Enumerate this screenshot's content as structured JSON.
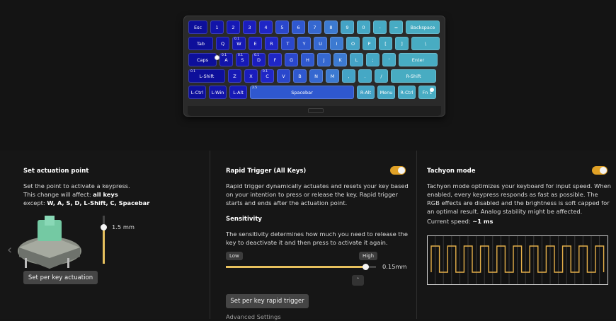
{
  "keyboard": {
    "rows": [
      [
        {
          "label": "Esc",
          "c": "#0d0f9a"
        },
        {
          "label": "1",
          "c": "#1214a8"
        },
        {
          "label": "2",
          "c": "#1619b5"
        },
        {
          "label": "3",
          "c": "#1a1dbd"
        },
        {
          "label": "4",
          "c": "#1f26c6"
        },
        {
          "label": "5",
          "c": "#2a47cc"
        },
        {
          "label": "6",
          "c": "#2f58cf"
        },
        {
          "label": "7",
          "c": "#3568d0"
        },
        {
          "label": "8",
          "c": "#3c7ad1"
        },
        {
          "label": "9",
          "c": "#44a3c6"
        },
        {
          "label": "0",
          "c": "#45a8c5"
        },
        {
          "label": "-",
          "c": "#46aac4"
        },
        {
          "label": "=",
          "c": "#47abc3"
        },
        {
          "label": "Backspace",
          "c": "#48acc2"
        }
      ],
      [
        {
          "label": "Tab",
          "c": "#0d0f9a"
        },
        {
          "label": "Q",
          "c": "#1214a8"
        },
        {
          "label": "W",
          "c": "#1619b5",
          "sup": "0.1"
        },
        {
          "label": "E",
          "c": "#1a1dbd"
        },
        {
          "label": "R",
          "c": "#1f26c6"
        },
        {
          "label": "T",
          "c": "#2a47cc"
        },
        {
          "label": "Y",
          "c": "#2f58cf"
        },
        {
          "label": "U",
          "c": "#3568d0"
        },
        {
          "label": "I",
          "c": "#3c7ad1"
        },
        {
          "label": "O",
          "c": "#44a3c6"
        },
        {
          "label": "P",
          "c": "#45a8c5"
        },
        {
          "label": "[",
          "c": "#46aac4"
        },
        {
          "label": "]",
          "c": "#47abc3"
        },
        {
          "label": "\\",
          "c": "#48acc2"
        }
      ],
      [
        {
          "label": "Caps",
          "c": "#0d0f9a"
        },
        {
          "label": "A",
          "c": "#1214a8",
          "sup": "0.1"
        },
        {
          "label": "S",
          "c": "#1619b5",
          "sup": "0.1"
        },
        {
          "label": "D",
          "c": "#1a1dbd",
          "sup": "0.1"
        },
        {
          "label": "F",
          "c": "#1f26c6"
        },
        {
          "label": "G",
          "c": "#2a47cc"
        },
        {
          "label": "H",
          "c": "#2f58cf"
        },
        {
          "label": "J",
          "c": "#3568d0"
        },
        {
          "label": "K",
          "c": "#3c7ad1"
        },
        {
          "label": "L",
          "c": "#44a3c6"
        },
        {
          "label": ";",
          "c": "#45a8c5"
        },
        {
          "label": "'",
          "c": "#46aac4"
        },
        {
          "label": "Enter",
          "c": "#48acc2"
        }
      ],
      [
        {
          "label": "L-Shift",
          "c": "#0d0f9a",
          "sup": "0.1"
        },
        {
          "label": "Z",
          "c": "#1619b5"
        },
        {
          "label": "X",
          "c": "#1a1dbd"
        },
        {
          "label": "C",
          "c": "#1f26c6",
          "sup": "0.1"
        },
        {
          "label": "V",
          "c": "#2a47cc"
        },
        {
          "label": "B",
          "c": "#2f58cf"
        },
        {
          "label": "N",
          "c": "#3568d0"
        },
        {
          "label": "M",
          "c": "#3c7ad1"
        },
        {
          "label": ",",
          "c": "#44a3c6"
        },
        {
          "label": ".",
          "c": "#45a8c5"
        },
        {
          "label": "/",
          "c": "#46aac4"
        },
        {
          "label": "R-Shift",
          "c": "#48acc2"
        }
      ],
      [
        {
          "label": "L-Ctrl",
          "c": "#0d0f9a"
        },
        {
          "label": "L-Win",
          "c": "#1214a8"
        },
        {
          "label": "L-Alt",
          "c": "#1619b5"
        },
        {
          "label": "Spacebar",
          "c": "#2f58cf",
          "sup": "2.5"
        },
        {
          "label": "R-Alt",
          "c": "#44a3c6"
        },
        {
          "label": "Menu",
          "c": "#45a8c5"
        },
        {
          "label": "R-Ctrl",
          "c": "#46aac4"
        },
        {
          "label": "Fn 1",
          "c": "#48acc2"
        }
      ]
    ]
  },
  "actuation": {
    "title": "Set actuation point",
    "desc1": "Set the point to activate a keypress.",
    "desc2_prefix": "This change will affect: ",
    "desc2_bold": "all keys",
    "desc3_prefix": "except: ",
    "desc3_bold": "W, A, S, D, L-Shift, C, Spacebar",
    "value": "1.5 mm",
    "button": "Set per key actuation",
    "prev_icon": "chevron-left-icon"
  },
  "rapid": {
    "title": "Rapid Trigger (All Keys)",
    "desc": "Rapid trigger dynamically actuates and resets your key based on your intention to press or release the key. Rapid trigger starts and ends after the actuation point.",
    "sens_title": "Sensitivity",
    "sens_desc": "The sensitivity determines how much you need to release the key to deactivate it and then press to activate it again.",
    "low": "Low",
    "high": "High",
    "value": "0.15mm",
    "level": 0.93,
    "button": "Set per key rapid trigger",
    "advanced": "Advanced Settings"
  },
  "tachyon": {
    "title": "Tachyon mode",
    "desc": "Tachyon mode optimizes your keyboard for input speed. When enabled, every keypress responds as fast as possible. The RGB effects are disabled and the brightness is soft capped for an optimal result. Analog stability might be affected.",
    "speed_prefix": "Current speed: ",
    "speed_value": "~1 ms"
  },
  "colors": {
    "accent": "#e0a126",
    "wave": "#e5b04a"
  }
}
